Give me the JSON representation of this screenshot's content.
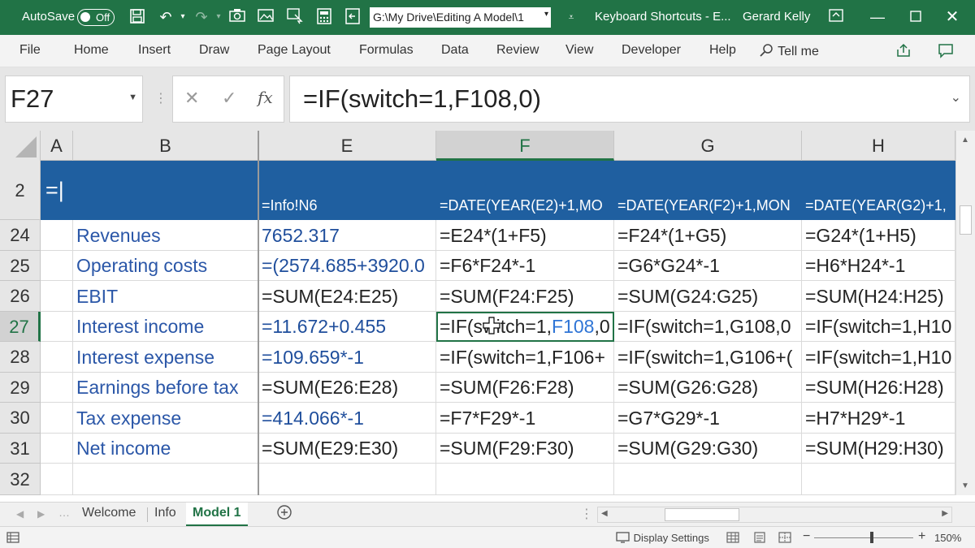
{
  "titlebar": {
    "autosave_label": "AutoSave",
    "autosave_state": "Off",
    "path": "G:\\My Drive\\Editing A Model\\1",
    "doc_title": "Keyboard Shortcuts - E...",
    "user": "Gerard Kelly",
    "bg_color": "#217346"
  },
  "menu": {
    "items": [
      "File",
      "Home",
      "Insert",
      "Draw",
      "Page Layout",
      "Formulas",
      "Data",
      "Review",
      "View",
      "Developer",
      "Help"
    ],
    "tell_me": "Tell me"
  },
  "formula_bar": {
    "name_box": "F27",
    "fx": "fx",
    "formula": "=IF(switch=1,F108,0)"
  },
  "columns": [
    "A",
    "B",
    "E",
    "F",
    "G",
    "H"
  ],
  "selected_column": "F",
  "rows": [
    {
      "num": "2",
      "A": "=|",
      "B": "",
      "E": "=Info!N6",
      "F": "=DATE(YEAR(E2)+1,MO",
      "G": "=DATE(YEAR(F2)+1,MON",
      "H": "=DATE(YEAR(G2)+1,"
    },
    {
      "num": "24",
      "B": "Revenues",
      "E": "7652.317",
      "F": "=E24*(1+F5)",
      "G": "=F24*(1+G5)",
      "H": "=G24*(1+H5)"
    },
    {
      "num": "25",
      "B": "Operating costs",
      "E": "=(2574.685+3920.0",
      "F": "=F6*F24*-1",
      "G": "=G6*G24*-1",
      "H": "=H6*H24*-1"
    },
    {
      "num": "26",
      "B": "EBIT",
      "E": "=SUM(E24:E25)",
      "F": "=SUM(F24:F25)",
      "G": "=SUM(G24:G25)",
      "H": "=SUM(H24:H25)"
    },
    {
      "num": "27",
      "B": "Interest income",
      "E": "=11.672+0.455",
      "F_pre": "=IF(switch=1,",
      "F_ref": "F108",
      "F_post": ",0",
      "G": "=IF(switch=1,G108,0",
      "H": "=IF(switch=1,H10"
    },
    {
      "num": "28",
      "B": "Interest expense",
      "E": "=109.659*-1",
      "F": "=IF(switch=1,F106+",
      "G": "=IF(switch=1,G106+(",
      "H": "=IF(switch=1,H10"
    },
    {
      "num": "29",
      "B": "Earnings before tax",
      "E": "=SUM(E26:E28)",
      "F": "=SUM(F26:F28)",
      "G": "=SUM(G26:G28)",
      "H": "=SUM(H26:H28)"
    },
    {
      "num": "30",
      "B": "Tax expense",
      "E": "=414.066*-1",
      "F": "=F7*F29*-1",
      "G": "=G7*G29*-1",
      "H": "=H7*H29*-1"
    },
    {
      "num": "31",
      "B": "Net income",
      "E": "=SUM(E29:E30)",
      "F": "=SUM(F29:F30)",
      "G": "=SUM(G29:G30)",
      "H": "=SUM(H29:H30)"
    },
    {
      "num": "32",
      "B": "",
      "E": "",
      "F": "",
      "G": "",
      "H": ""
    }
  ],
  "sheet_tabs": {
    "tabs": [
      "Welcome",
      "Info",
      "Model 1"
    ],
    "active": "Model 1"
  },
  "statusbar": {
    "display_settings": "Display Settings",
    "zoom": "150%"
  }
}
